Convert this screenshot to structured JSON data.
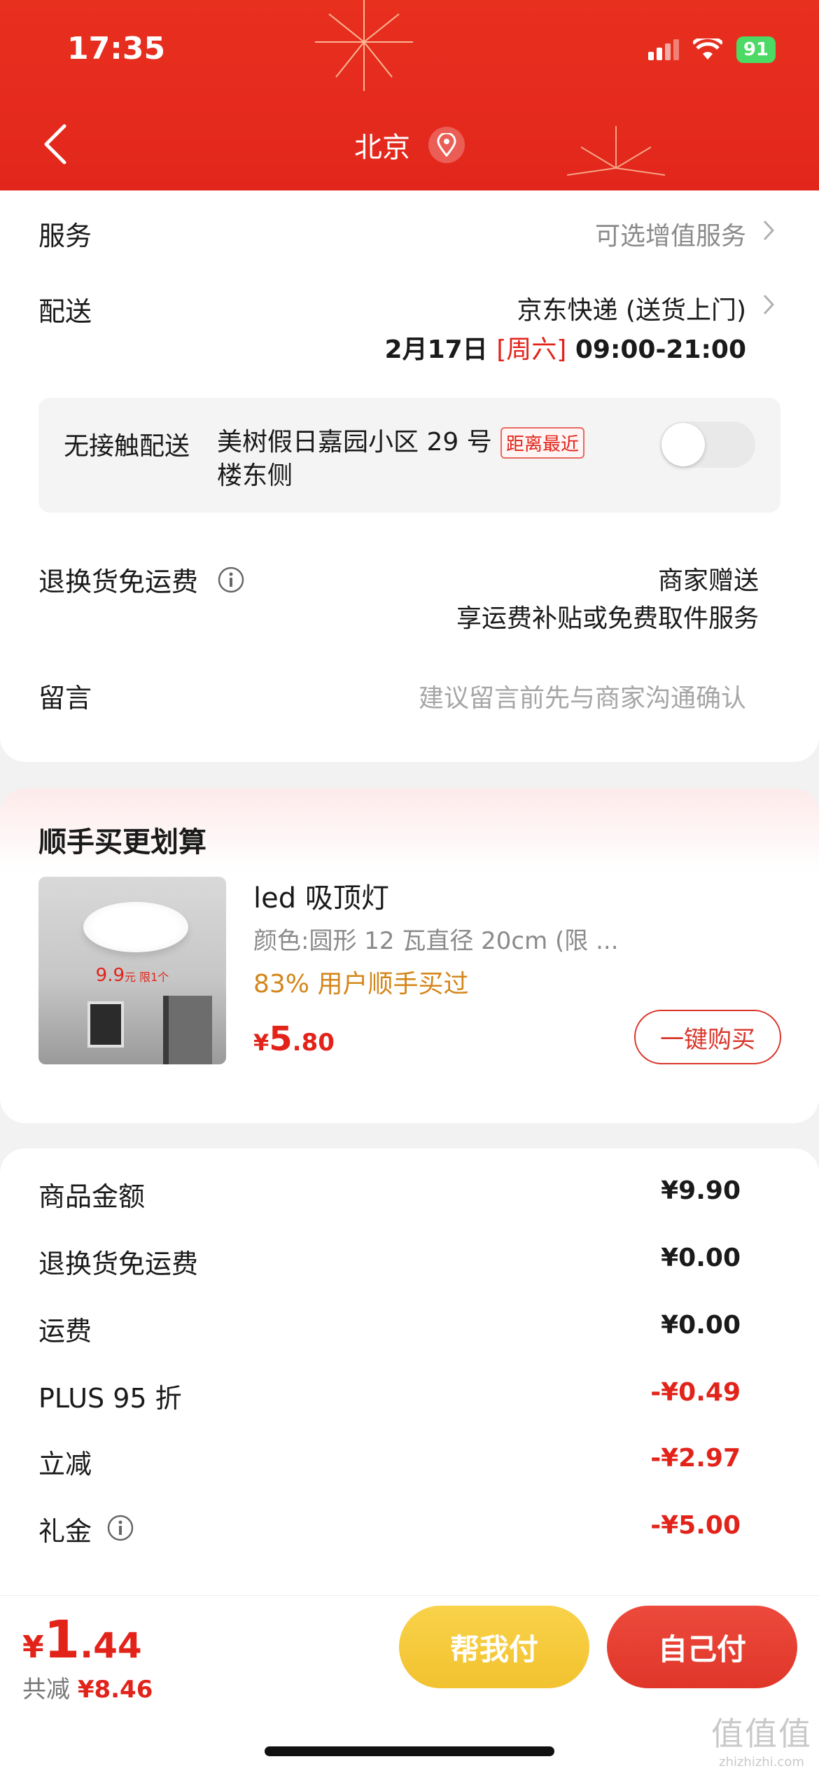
{
  "status_bar": {
    "time": "17:35",
    "battery": "91"
  },
  "header": {
    "city": "北京"
  },
  "service": {
    "label": "服务",
    "value": "可选增值服务"
  },
  "delivery": {
    "label": "配送",
    "method": "京东快递 (送货上门)",
    "date": "2月17日",
    "weekday": "[周六]",
    "time_range": "09:00-21:00"
  },
  "contactless": {
    "label": "无接触配送",
    "address": "美树假日嘉园小区 29 号楼东侧",
    "tag": "距离最近",
    "enabled": false
  },
  "return_shipping": {
    "label": "退换货免运费",
    "value_line1": "商家赠送",
    "value_line2": "享运费补贴或免费取件服务"
  },
  "message": {
    "label": "留言",
    "placeholder": "建议留言前先与商家沟通确认"
  },
  "upsell": {
    "title": "顺手买更划算",
    "product": {
      "name": "led 吸顶灯",
      "spec": "颜色:圆形 12 瓦直径 20cm (限 ...",
      "bought": "83% 用户顺手买过",
      "price_currency": "¥",
      "price_int": "5",
      "price_dec": ".80",
      "image_price": "9.9",
      "image_price_unit": "元 限1个",
      "buy_label": "一键购买"
    }
  },
  "summary": [
    {
      "label": "商品金额",
      "value": "¥9.90",
      "negative": false
    },
    {
      "label": "退换货免运费",
      "value": "¥0.00",
      "negative": false
    },
    {
      "label": "运费",
      "value": "¥0.00",
      "negative": false
    },
    {
      "label": "PLUS 95 折",
      "value": "-¥0.49",
      "negative": true
    },
    {
      "label": "立减",
      "value": "-¥2.97",
      "negative": true
    },
    {
      "label": "礼金",
      "value": "-¥5.00",
      "negative": true
    }
  ],
  "checkout": {
    "total_currency": "¥",
    "total_int": "1",
    "total_dec": ".44",
    "saved_label": "共减",
    "saved_amount": "¥8.46",
    "help_pay_label": "帮我付",
    "self_pay_label": "自己付"
  },
  "watermark": {
    "line1": "值值值",
    "line2": "zhizhizhi.com"
  },
  "colors": {
    "brand_red": "#e2231a",
    "header_red": "#e2261c",
    "help_yellow": "#f2c22f"
  }
}
